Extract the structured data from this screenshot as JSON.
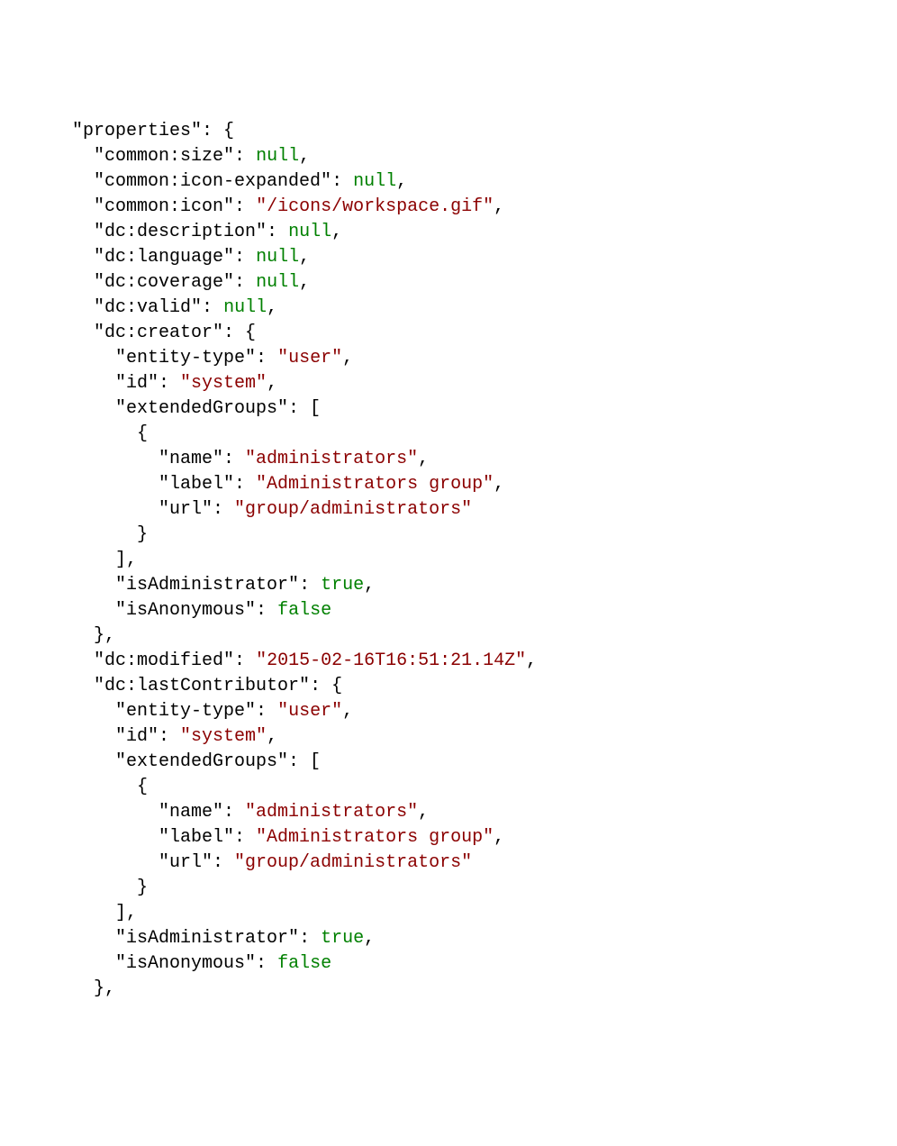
{
  "code": {
    "root_key": "properties",
    "fields": [
      {
        "key": "common:size",
        "type": "literal",
        "value": "null"
      },
      {
        "key": "common:icon-expanded",
        "type": "literal",
        "value": "null"
      },
      {
        "key": "common:icon",
        "type": "string",
        "value": "/icons/workspace.gif"
      },
      {
        "key": "dc:description",
        "type": "literal",
        "value": "null"
      },
      {
        "key": "dc:language",
        "type": "literal",
        "value": "null"
      },
      {
        "key": "dc:coverage",
        "type": "literal",
        "value": "null"
      },
      {
        "key": "dc:valid",
        "type": "literal",
        "value": "null"
      },
      {
        "key": "dc:creator",
        "type": "user_object",
        "entity_type": "user",
        "id": "system",
        "group": {
          "name": "administrators",
          "label": "Administrators group",
          "url": "group/administrators"
        },
        "isAdministrator": "true",
        "isAnonymous": "false"
      },
      {
        "key": "dc:modified",
        "type": "string",
        "value": "2015-02-16T16:51:21.14Z"
      },
      {
        "key": "dc:lastContributor",
        "type": "user_object",
        "entity_type": "user",
        "id": "system",
        "group": {
          "name": "administrators",
          "label": "Administrators group",
          "url": "group/administrators"
        },
        "isAdministrator": "true",
        "isAnonymous": "false"
      }
    ],
    "labels": {
      "entity_type": "entity-type",
      "id": "id",
      "extendedGroups": "extendedGroups",
      "name": "name",
      "label": "label",
      "url": "url",
      "isAdministrator": "isAdministrator",
      "isAnonymous": "isAnonymous"
    }
  }
}
